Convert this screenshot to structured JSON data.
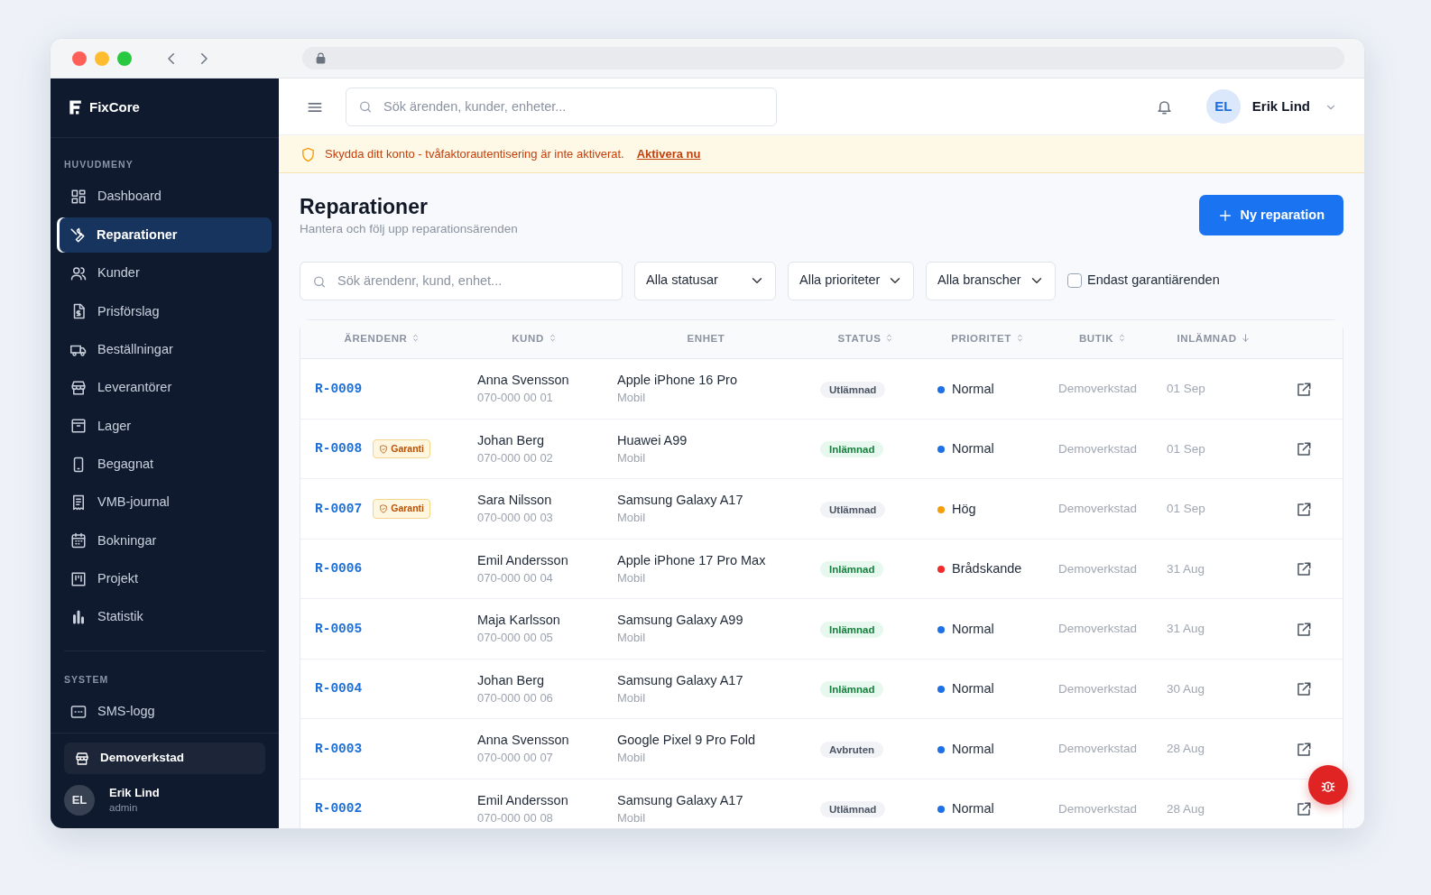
{
  "sidebar": {
    "brand": "FixCore",
    "sections": [
      {
        "title": "HUVUDMENY",
        "items": [
          {
            "label": "Dashboard",
            "selected": false
          },
          {
            "label": "Reparationer",
            "selected": true
          },
          {
            "label": "Kunder",
            "selected": false
          },
          {
            "label": "Prisförslag",
            "selected": false
          },
          {
            "label": "Beställningar",
            "selected": false
          },
          {
            "label": "Leverantörer",
            "selected": false
          },
          {
            "label": "Lager",
            "selected": false
          },
          {
            "label": "Begagnat",
            "selected": false
          },
          {
            "label": "VMB-journal",
            "selected": false
          },
          {
            "label": "Bokningar",
            "selected": false
          },
          {
            "label": "Projekt",
            "selected": false
          },
          {
            "label": "Statistik",
            "selected": false
          }
        ]
      },
      {
        "title": "SYSTEM",
        "items": [
          {
            "label": "SMS-logg",
            "selected": false
          }
        ]
      }
    ],
    "store": "Demoverkstad",
    "user": {
      "initials": "EL",
      "name": "Erik Lind",
      "role": "admin"
    }
  },
  "topbar": {
    "search": {
      "placeholder": "Sök ärenden, kunder, enheter..."
    },
    "user": {
      "initials": "EL",
      "name": "Erik Lind"
    }
  },
  "alert": {
    "text": "Skydda ditt konto - tvåfaktorautentisering är inte aktiverat.",
    "link": "Aktivera nu"
  },
  "page": {
    "title": "Reparationer",
    "subtitle": "Hantera och följ upp reparationsärenden",
    "new_button": "Ny reparation"
  },
  "filters": {
    "search": {
      "placeholder": "Sök ärendenr, kund, enhet..."
    },
    "selects": [
      "Alla statusar",
      "Alla prioriteter",
      "Alla branscher"
    ],
    "warranty_only": {
      "label": "Endast garantiärenden",
      "checked": false
    }
  },
  "table": {
    "columns": [
      {
        "label": "ÄRENDENR",
        "sortable": true
      },
      {
        "label": "KUND",
        "sortable": true
      },
      {
        "label": "ENHET",
        "sortable": false
      },
      {
        "label": "STATUS",
        "sortable": true
      },
      {
        "label": "PRIORITET",
        "sortable": true
      },
      {
        "label": "BUTIK",
        "sortable": true
      },
      {
        "label": "INLÄMNAD",
        "sortable": true,
        "sorted_descending": true
      }
    ],
    "rows": [
      {
        "id": "R-0009",
        "customer": "Anna Svensson",
        "phone": "070-000 00 01",
        "device": "Apple iPhone 16 Pro",
        "category": "Mobil",
        "status": {
          "label": "Utlämnad",
          "kind": "neutral"
        },
        "priority": {
          "label": "Normal",
          "color": "#1f6fe5"
        },
        "store": "Demoverkstad",
        "date": "01 Sep"
      },
      {
        "id": "R-0008",
        "badge": "Garanti",
        "customer": "Johan Berg",
        "phone": "070-000 00 02",
        "device": "Huawei A99",
        "category": "Mobil",
        "status": {
          "label": "Inlämnad",
          "kind": "success"
        },
        "priority": {
          "label": "Normal",
          "color": "#1f6fe5"
        },
        "store": "Demoverkstad",
        "date": "01 Sep"
      },
      {
        "id": "R-0007",
        "badge": "Garanti",
        "customer": "Sara Nilsson",
        "phone": "070-000 00 03",
        "device": "Samsung Galaxy A17",
        "category": "Mobil",
        "status": {
          "label": "Utlämnad",
          "kind": "neutral"
        },
        "priority": {
          "label": "Hög",
          "color": "#f59e0b"
        },
        "store": "Demoverkstad",
        "date": "01 Sep"
      },
      {
        "id": "R-0006",
        "customer": "Emil Andersson",
        "phone": "070-000 00 04",
        "device": "Apple iPhone 17 Pro Max",
        "category": "Mobil",
        "status": {
          "label": "Inlämnad",
          "kind": "success"
        },
        "priority": {
          "label": "Brådskande",
          "color": "#ef2b2b"
        },
        "store": "Demoverkstad",
        "date": "31 Aug"
      },
      {
        "id": "R-0005",
        "customer": "Maja Karlsson",
        "phone": "070-000 00 05",
        "device": "Samsung Galaxy A99",
        "category": "Mobil",
        "status": {
          "label": "Inlämnad",
          "kind": "success"
        },
        "priority": {
          "label": "Normal",
          "color": "#1f6fe5"
        },
        "store": "Demoverkstad",
        "date": "31 Aug"
      },
      {
        "id": "R-0004",
        "customer": "Johan Berg",
        "phone": "070-000 00 06",
        "device": "Samsung Galaxy A17",
        "category": "Mobil",
        "status": {
          "label": "Inlämnad",
          "kind": "success"
        },
        "priority": {
          "label": "Normal",
          "color": "#1f6fe5"
        },
        "store": "Demoverkstad",
        "date": "30 Aug"
      },
      {
        "id": "R-0003",
        "customer": "Anna Svensson",
        "phone": "070-000 00 07",
        "device": "Google Pixel 9 Pro Fold",
        "category": "Mobil",
        "status": {
          "label": "Avbruten",
          "kind": "neutral"
        },
        "priority": {
          "label": "Normal",
          "color": "#1f6fe5"
        },
        "store": "Demoverkstad",
        "date": "28 Aug"
      },
      {
        "id": "R-0002",
        "customer": "Emil Andersson",
        "phone": "070-000 00 08",
        "device": "Samsung Galaxy A17",
        "category": "Mobil",
        "status": {
          "label": "Utlämnad",
          "kind": "neutral"
        },
        "priority": {
          "label": "Normal",
          "color": "#1f6fe5"
        },
        "store": "Demoverkstad",
        "date": "28 Aug"
      }
    ]
  }
}
